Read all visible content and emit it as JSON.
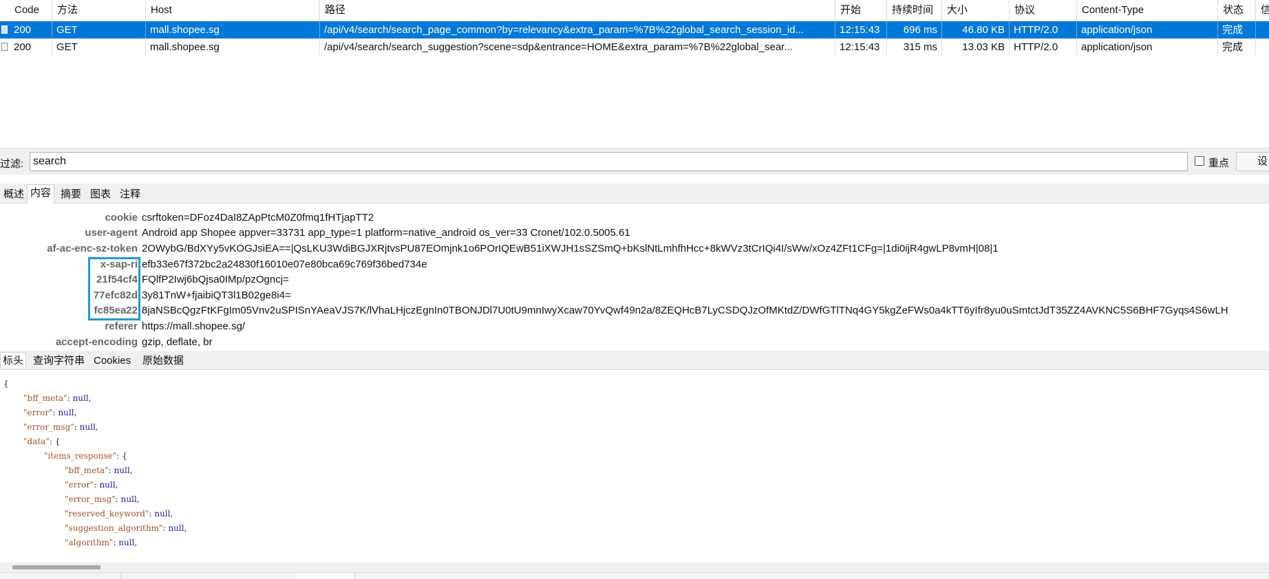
{
  "table": {
    "columns": [
      "Code",
      "方法",
      "Host",
      "路径",
      "开始",
      "持续时间",
      "大小",
      "协议",
      "Content-Type",
      "状态",
      "信"
    ],
    "rows": [
      {
        "code": "200",
        "method": "GET",
        "host": "mall.shopee.sg",
        "path": "/api/v4/search/search_page_common?by=relevancy&extra_param=%7B%22global_search_session_id...",
        "start": "12:15:43",
        "duration": "696 ms",
        "size": "46.80 KB",
        "protocol": "HTTP/2.0",
        "content_type": "application/json",
        "status": "完成",
        "selected": true
      },
      {
        "code": "200",
        "method": "GET",
        "host": "mall.shopee.sg",
        "path": "/api/v4/search/search_suggestion?scene=sdp&entrance=HOME&extra_param=%7B%22global_sear...",
        "start": "12:15:43",
        "duration": "315 ms",
        "size": "13.03 KB",
        "protocol": "HTTP/2.0",
        "content_type": "application/json",
        "status": "完成",
        "selected": false
      }
    ]
  },
  "filter": {
    "label": "过滤:",
    "value": "search",
    "highlight_label": "重点",
    "settings_label": "设"
  },
  "detail_tabs": [
    "概述",
    "内容",
    "摘要",
    "图表",
    "注释"
  ],
  "active_detail_tab": "内容",
  "headers": [
    {
      "name": "cookie",
      "value": "csrftoken=DFoz4DaI8ZApPtcM0Z0fmq1fHTjapTT2"
    },
    {
      "name": "user-agent",
      "value": "Android app Shopee appver=33731 app_type=1 platform=native_android os_ver=33 Cronet/102.0.5005.61"
    },
    {
      "name": "af-ac-enc-sz-token",
      "value": "2OWybG/BdXYy5vKOGJsiEA==|QsLKU3WdiBGJXRjtvsPU87EOmjnk1o6POrIQEwB51iXWJH1sSZSmQ+bKslNtLmhfhHcc+8kWVz3tCrIQi4I/sWw/xOz4ZFt1CFg=|1di0ijR4gwLP8vmH|08|1"
    },
    {
      "name": "x-sap-ri",
      "value": "efb33e67f372bc2a24830f16010e07e80bca69c769f36bed734e"
    },
    {
      "name": "21f54cf4",
      "value": "FQlfP2Iwj6bQjsa0IMp/pzOgncj="
    },
    {
      "name": "77efc82d",
      "value": "3y81TnW+fjaibiQT3l1B02ge8i4="
    },
    {
      "name": "fc85ea22",
      "value": "8jaNSBcQgzFtKFgIm05Vnv2uSPISnYAeaVJS7K/lVhaLHjczEgnIn0TBONJDl7U0tU9mnIwyXcaw70YvQwf49n2a/8ZEQHcB7LyCSDQJzOfMKtdZ/DWfGTlTNq4GY5kgZeFWs0a4kTT6yIfr8yu0uSmtctJdT35ZZ4AVKNC5S6BHF7Gyqs4S6wLH"
    },
    {
      "name": "referer",
      "value": "https://mall.shopee.sg/"
    },
    {
      "name": "accept-encoding",
      "value": "gzip, deflate, br"
    }
  ],
  "sub_tabs": [
    "标头",
    "查询字符串",
    "Cookies",
    "原始数据"
  ],
  "active_sub_tab": "标头",
  "json_lines": [
    {
      "indent": 0,
      "key": "",
      "value": "{"
    },
    {
      "indent": 1,
      "key": "\"bff_meta\"",
      "value": "null"
    },
    {
      "indent": 1,
      "key": "\"error\"",
      "value": "null"
    },
    {
      "indent": 1,
      "key": "\"error_msg\"",
      "value": "null"
    },
    {
      "indent": 1,
      "key": "\"data\"",
      "value": "{"
    },
    {
      "indent": 2,
      "key": "\"items_response\"",
      "value": "{"
    },
    {
      "indent": 3,
      "key": "\"bff_meta\"",
      "value": "null"
    },
    {
      "indent": 3,
      "key": "\"error\"",
      "value": "null"
    },
    {
      "indent": 3,
      "key": "\"error_msg\"",
      "value": "null"
    },
    {
      "indent": 3,
      "key": "\"reserved_keyword\"",
      "value": "null"
    },
    {
      "indent": 3,
      "key": "\"suggestion_algorithm\"",
      "value": "null"
    },
    {
      "indent": 3,
      "key": "\"algorithm\"",
      "value": "null"
    }
  ],
  "colors": {
    "selection": "#0078d7",
    "redaction_box": "#1e9ad6",
    "json_key": "#a0522d",
    "json_null": "#1a1aa6"
  }
}
